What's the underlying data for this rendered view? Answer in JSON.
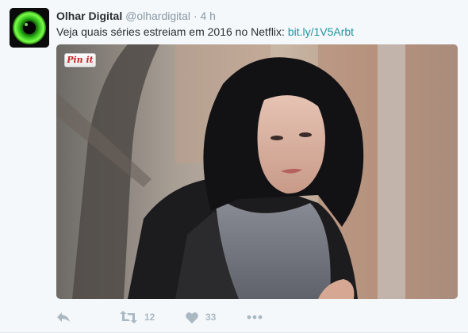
{
  "tweet": {
    "display_name": "Olhar Digital",
    "handle": "@olhardigital",
    "separator": "·",
    "timestamp": "4 h",
    "text": "Veja quais séries estreiam em 2016 no Netflix: ",
    "link_text": "bit.ly/1V5Arbt",
    "avatar_icon": "green-eye-logo",
    "media": {
      "description_icon": "photo",
      "pin_label": "Pin it"
    },
    "actions": {
      "reply_icon": "reply-icon",
      "retweet_count": "12",
      "like_count": "33",
      "more_icon": "more-icon"
    },
    "colors": {
      "link": "#1b95a0",
      "muted": "#8899a6",
      "action_icon": "#aab8c2",
      "background": "#f5f8fa",
      "pin_red": "#cb2027"
    }
  }
}
